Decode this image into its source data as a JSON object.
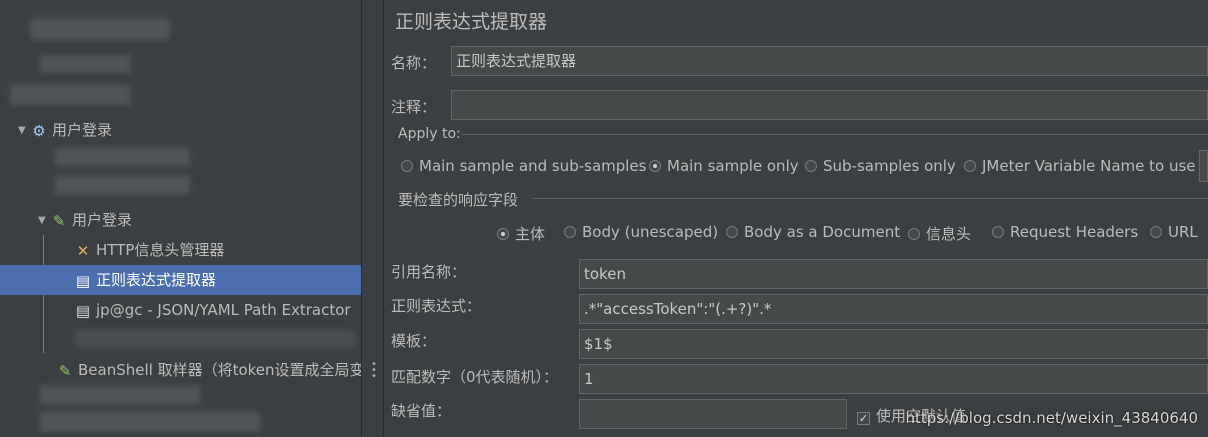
{
  "tree": {
    "items": [
      {
        "label": "用户登录",
        "icon": "gear-icon"
      },
      {
        "label": "用户登录",
        "icon": "pipette-icon"
      },
      {
        "label": "HTTP信息头管理器",
        "icon": "wrench-icon"
      },
      {
        "label": "正则表达式提取器",
        "icon": "document-icon"
      },
      {
        "label": "jp@gc - JSON/YAML Path Extractor",
        "icon": "document-icon"
      },
      {
        "label": "BeanShell 取样器（将token设置成全局变",
        "icon": "pipette-icon"
      }
    ]
  },
  "panel": {
    "title": "正则表达式提取器",
    "name_label": "名称：",
    "name_value": "正则表达式提取器",
    "comment_label": "注释：",
    "comment_value": "",
    "apply_to": {
      "label": "Apply to:",
      "options": [
        "Main sample and sub-samples",
        "Main sample only",
        "Sub-samples only",
        "JMeter Variable Name to use"
      ],
      "selected": "Main sample only"
    },
    "field_to_check": {
      "label": "要检查的响应字段",
      "options": [
        "主体",
        "Body (unescaped)",
        "Body as a Document",
        "信息头",
        "Request Headers",
        "URL"
      ],
      "selected": "主体"
    },
    "ref_name_label": "引用名称：",
    "ref_name_value": "token",
    "regex_label": "正则表达式：",
    "regex_value": ".*\"accessToken\":\"(.+?)\".*",
    "template_label": "模板：",
    "template_value": "$1$",
    "match_no_label": "匹配数字（0代表随机）：",
    "match_no_value": "1",
    "default_label": "缺省值：",
    "default_value": "",
    "use_empty_label": "使用空默认值",
    "use_empty_checked": true
  },
  "watermark": "https://blog.csdn.net/weixin_43840640"
}
